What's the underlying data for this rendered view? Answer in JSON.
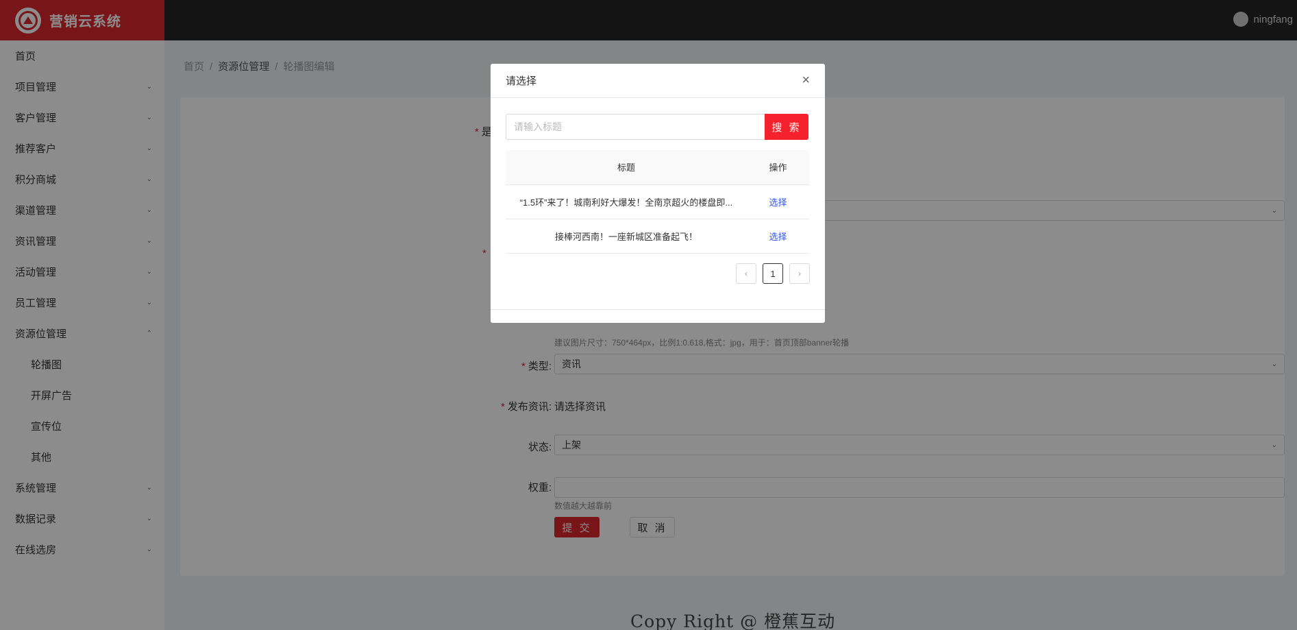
{
  "app": {
    "title": "营销云系统",
    "user": "ningfang"
  },
  "sidebar": {
    "items": [
      {
        "label": "首页",
        "chevron": ""
      },
      {
        "label": "项目管理",
        "chevron": "⌄"
      },
      {
        "label": "客户管理",
        "chevron": "⌄"
      },
      {
        "label": "推荐客户",
        "chevron": "⌄"
      },
      {
        "label": "积分商城",
        "chevron": "⌄"
      },
      {
        "label": "渠道管理",
        "chevron": "⌄"
      },
      {
        "label": "资讯管理",
        "chevron": "⌄"
      },
      {
        "label": "活动管理",
        "chevron": "⌄"
      },
      {
        "label": "员工管理",
        "chevron": "⌄"
      },
      {
        "label": "资源位管理",
        "chevron": "⌃"
      }
    ],
    "subitems": [
      "轮播图",
      "开屏广告",
      "宣传位",
      "其他"
    ],
    "items_after": [
      {
        "label": "系统管理",
        "chevron": "⌄"
      },
      {
        "label": "数据记录",
        "chevron": "⌄"
      },
      {
        "label": "在线选房",
        "chevron": "⌄"
      }
    ]
  },
  "breadcrumb": {
    "home": "首页",
    "section": "资源位管理",
    "current": "轮播图编辑",
    "sep": "/"
  },
  "form": {
    "partial_label": "是",
    "hint_image": "建议图片尺寸：750*464px，比例1:0.618,格式：jpg，用于：首页顶部banner轮播",
    "type_label": "类型:",
    "type_value": "资讯",
    "publish_label": "发布资讯:",
    "publish_value": "请选择资讯",
    "status_label": "状态:",
    "status_value": "上架",
    "weight_label": "权重:",
    "weight_hint": "数值越大越靠前",
    "submit": "提 交",
    "cancel": "取 消"
  },
  "footer": {
    "text": "Copy Right @ 橙蕉互动"
  },
  "modal": {
    "title": "请选择",
    "close": "×",
    "search_placeholder": "请输入标题",
    "search_button": "搜 索",
    "columns": [
      "标题",
      "操作"
    ],
    "rows": [
      {
        "title": "“1.5环”来了！城南利好大爆发！全南京超火的楼盘即...",
        "action": "选择"
      },
      {
        "title": "接棒河西南！一座新城区准备起飞！",
        "action": "选择"
      }
    ],
    "pager": {
      "prev": "‹",
      "page": "1",
      "next": "›"
    }
  },
  "colors": {
    "brand": "#d9272e",
    "topbar": "#262626",
    "link": "#2f54eb"
  }
}
